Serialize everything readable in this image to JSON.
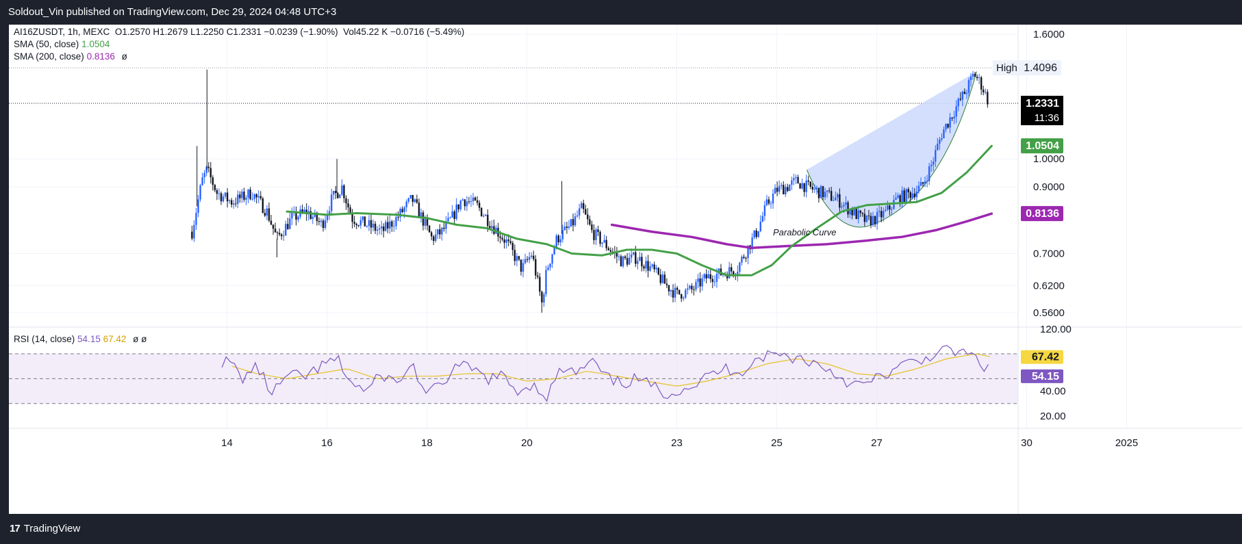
{
  "header": {
    "publisher_line": "Soldout_Vin published on TradingView.com, Dec 29, 2024 04:48 UTC+3"
  },
  "footer": {
    "logo": "17",
    "brand": "TradingView"
  },
  "legend": {
    "symbol": "AI16ZUSDT, 1h, MEXC",
    "ohlc": "O1.2570  H1.2679  L1.2250  C1.2331  −0.0239 (−1.90%)",
    "volume": "Vol45.22 K  −0.0716 (−5.49%)",
    "sma50_label": "SMA (50, close)",
    "sma50_value": "1.0504",
    "sma200_label": "SMA (200, close)",
    "sma200_value": "0.8136",
    "eye_symbol": "ø",
    "rsi_label": "RSI (14, close)",
    "rsi_value": "54.15",
    "rsi_ma_value": "67.42",
    "rsi_eye": "ø  ø"
  },
  "colors": {
    "up": "#2962ff",
    "down": "#131722",
    "sma50": "#43a047",
    "sma200": "#9c27b0",
    "rsi": "#7e57c2",
    "rsi_ma": "#e6c229",
    "pattern_fill": "#cbd9fb"
  },
  "chart_data": {
    "type": "candlestick",
    "x_ticks": [
      "14",
      "16",
      "18",
      "20",
      "23",
      "25",
      "27",
      "30",
      "2025"
    ],
    "x_tick_positions_days": [
      14,
      16,
      18,
      20,
      23,
      25,
      27,
      30,
      32
    ],
    "price_ticks": [
      "1.6000",
      "1.0000",
      "0.9000",
      "0.7000",
      "0.6200",
      "0.5600"
    ],
    "price_tick_values": [
      1.6,
      1.0,
      0.9,
      0.7,
      0.62,
      0.56
    ],
    "price_scale": "log",
    "price_range": [
      0.53,
      1.72
    ],
    "high_label": "High",
    "high_value": "1.4096",
    "high_numeric": 1.4096,
    "last_price": "1.2331",
    "last_price_numeric": 1.2331,
    "countdown": "11:36",
    "sma50_tag": "1.0504",
    "sma50_numeric": 1.0504,
    "sma200_tag": "0.8136",
    "sma200_numeric": 0.8136,
    "annotation": "Parabolic Curve",
    "candle_keypoints": [
      [
        13.3,
        0.76
      ],
      [
        13.5,
        0.92
      ],
      [
        13.6,
        0.96
      ],
      [
        13.8,
        0.88
      ],
      [
        14.1,
        0.85
      ],
      [
        14.5,
        0.88
      ],
      [
        14.8,
        0.82
      ],
      [
        15.0,
        0.74
      ],
      [
        15.3,
        0.8
      ],
      [
        15.6,
        0.82
      ],
      [
        15.9,
        0.78
      ],
      [
        16.1,
        0.86
      ],
      [
        16.3,
        0.9
      ],
      [
        16.5,
        0.8
      ],
      [
        16.8,
        0.78
      ],
      [
        17.1,
        0.76
      ],
      [
        17.4,
        0.8
      ],
      [
        17.7,
        0.86
      ],
      [
        17.9,
        0.8
      ],
      [
        18.1,
        0.74
      ],
      [
        18.3,
        0.76
      ],
      [
        18.5,
        0.8
      ],
      [
        18.7,
        0.86
      ],
      [
        19.0,
        0.84
      ],
      [
        19.3,
        0.78
      ],
      [
        19.6,
        0.73
      ],
      [
        19.9,
        0.66
      ],
      [
        20.1,
        0.7
      ],
      [
        20.3,
        0.58
      ],
      [
        20.4,
        0.66
      ],
      [
        20.6,
        0.74
      ],
      [
        20.9,
        0.78
      ],
      [
        21.1,
        0.83
      ],
      [
        21.3,
        0.76
      ],
      [
        21.6,
        0.72
      ],
      [
        21.9,
        0.68
      ],
      [
        22.2,
        0.69
      ],
      [
        22.5,
        0.66
      ],
      [
        22.8,
        0.62
      ],
      [
        23.0,
        0.6
      ],
      [
        23.3,
        0.61
      ],
      [
        23.6,
        0.64
      ],
      [
        23.9,
        0.65
      ],
      [
        24.2,
        0.66
      ],
      [
        24.4,
        0.71
      ],
      [
        24.6,
        0.76
      ],
      [
        24.8,
        0.84
      ],
      [
        25.0,
        0.89
      ],
      [
        25.2,
        0.9
      ],
      [
        25.4,
        0.92
      ],
      [
        25.6,
        0.9
      ],
      [
        25.9,
        0.88
      ],
      [
        26.2,
        0.86
      ],
      [
        26.5,
        0.82
      ],
      [
        26.8,
        0.79
      ],
      [
        27.0,
        0.8
      ],
      [
        27.2,
        0.82
      ],
      [
        27.4,
        0.86
      ],
      [
        27.7,
        0.88
      ],
      [
        27.9,
        0.9
      ],
      [
        28.1,
        0.98
      ],
      [
        28.3,
        1.1
      ],
      [
        28.6,
        1.22
      ],
      [
        28.8,
        1.3
      ],
      [
        28.95,
        1.38
      ],
      [
        29.1,
        1.32
      ],
      [
        29.25,
        1.2331
      ]
    ],
    "wick_highs": [
      [
        13.6,
        1.4
      ],
      [
        13.4,
        1.05
      ],
      [
        16.2,
        1.0
      ],
      [
        20.7,
        0.92
      ],
      [
        20.3,
        0.56
      ],
      [
        15.0,
        0.69
      ]
    ],
    "sma50": [
      [
        15.2,
        0.82
      ],
      [
        16.0,
        0.81
      ],
      [
        16.6,
        0.815
      ],
      [
        17.4,
        0.81
      ],
      [
        18.0,
        0.8
      ],
      [
        18.6,
        0.78
      ],
      [
        19.2,
        0.77
      ],
      [
        19.8,
        0.74
      ],
      [
        20.4,
        0.725
      ],
      [
        20.9,
        0.7
      ],
      [
        21.5,
        0.695
      ],
      [
        22.0,
        0.71
      ],
      [
        22.5,
        0.71
      ],
      [
        23.0,
        0.7
      ],
      [
        23.5,
        0.67
      ],
      [
        24.0,
        0.645
      ],
      [
        24.5,
        0.645
      ],
      [
        24.9,
        0.67
      ],
      [
        25.3,
        0.72
      ],
      [
        25.8,
        0.77
      ],
      [
        26.3,
        0.82
      ],
      [
        26.8,
        0.84
      ],
      [
        27.3,
        0.845
      ],
      [
        27.8,
        0.85
      ],
      [
        28.3,
        0.88
      ],
      [
        28.8,
        0.95
      ],
      [
        29.3,
        1.0504
      ]
    ],
    "sma200": [
      [
        21.7,
        0.78
      ],
      [
        22.5,
        0.76
      ],
      [
        23.3,
        0.745
      ],
      [
        24.0,
        0.725
      ],
      [
        24.5,
        0.715
      ],
      [
        25.2,
        0.72
      ],
      [
        26.0,
        0.725
      ],
      [
        26.8,
        0.735
      ],
      [
        27.5,
        0.745
      ],
      [
        28.2,
        0.765
      ],
      [
        28.8,
        0.79
      ],
      [
        29.3,
        0.8136
      ]
    ],
    "rsi_ticks": [
      "120.00",
      "67.42",
      "54.15",
      "40.00",
      "20.00"
    ],
    "rsi_tick_values": [
      120,
      67.42,
      54.15,
      40,
      20
    ],
    "rsi_range": [
      10,
      120
    ],
    "rsi_bands": [
      70,
      50,
      30
    ],
    "rsi_last": 54.15,
    "rsi_ma_last": 67.42,
    "rsi_keypoints": [
      [
        13.9,
        64
      ],
      [
        14.1,
        62
      ],
      [
        14.3,
        50
      ],
      [
        14.6,
        60
      ],
      [
        14.9,
        38
      ],
      [
        15.2,
        52
      ],
      [
        15.6,
        52
      ],
      [
        15.9,
        60
      ],
      [
        16.2,
        66
      ],
      [
        16.5,
        46
      ],
      [
        16.8,
        40
      ],
      [
        17.1,
        54
      ],
      [
        17.4,
        46
      ],
      [
        17.7,
        62
      ],
      [
        18.0,
        36
      ],
      [
        18.3,
        46
      ],
      [
        18.6,
        60
      ],
      [
        18.9,
        58
      ],
      [
        19.2,
        50
      ],
      [
        19.5,
        52
      ],
      [
        19.8,
        40
      ],
      [
        20.1,
        46
      ],
      [
        20.4,
        36
      ],
      [
        20.7,
        58
      ],
      [
        21.0,
        54
      ],
      [
        21.3,
        64
      ],
      [
        21.6,
        50
      ],
      [
        21.9,
        46
      ],
      [
        22.2,
        50
      ],
      [
        22.5,
        44
      ],
      [
        22.8,
        38
      ],
      [
        23.1,
        42
      ],
      [
        23.4,
        46
      ],
      [
        23.7,
        54
      ],
      [
        24.0,
        58
      ],
      [
        24.3,
        56
      ],
      [
        24.6,
        66
      ],
      [
        24.9,
        70
      ],
      [
        25.2,
        68
      ],
      [
        25.5,
        66
      ],
      [
        25.8,
        62
      ],
      [
        26.1,
        56
      ],
      [
        26.4,
        48
      ],
      [
        26.7,
        44
      ],
      [
        27.0,
        50
      ],
      [
        27.3,
        56
      ],
      [
        27.6,
        62
      ],
      [
        27.9,
        64
      ],
      [
        28.2,
        72
      ],
      [
        28.5,
        72
      ],
      [
        28.8,
        70
      ],
      [
        29.0,
        66
      ],
      [
        29.2,
        58
      ],
      [
        29.3,
        54.15
      ]
    ],
    "rsi_ma_keypoints": [
      [
        14.1,
        60
      ],
      [
        14.6,
        54
      ],
      [
        15.2,
        50
      ],
      [
        15.8,
        54
      ],
      [
        16.4,
        58
      ],
      [
        17.0,
        50
      ],
      [
        17.6,
        52
      ],
      [
        18.2,
        52
      ],
      [
        18.8,
        54
      ],
      [
        19.4,
        54
      ],
      [
        20.0,
        48
      ],
      [
        20.6,
        50
      ],
      [
        21.2,
        56
      ],
      [
        21.8,
        52
      ],
      [
        22.4,
        48
      ],
      [
        23.0,
        44
      ],
      [
        23.6,
        48
      ],
      [
        24.2,
        54
      ],
      [
        24.8,
        62
      ],
      [
        25.4,
        66
      ],
      [
        26.0,
        62
      ],
      [
        26.6,
        54
      ],
      [
        27.2,
        52
      ],
      [
        27.8,
        58
      ],
      [
        28.4,
        66
      ],
      [
        29.0,
        70
      ],
      [
        29.3,
        67.42
      ]
    ]
  }
}
